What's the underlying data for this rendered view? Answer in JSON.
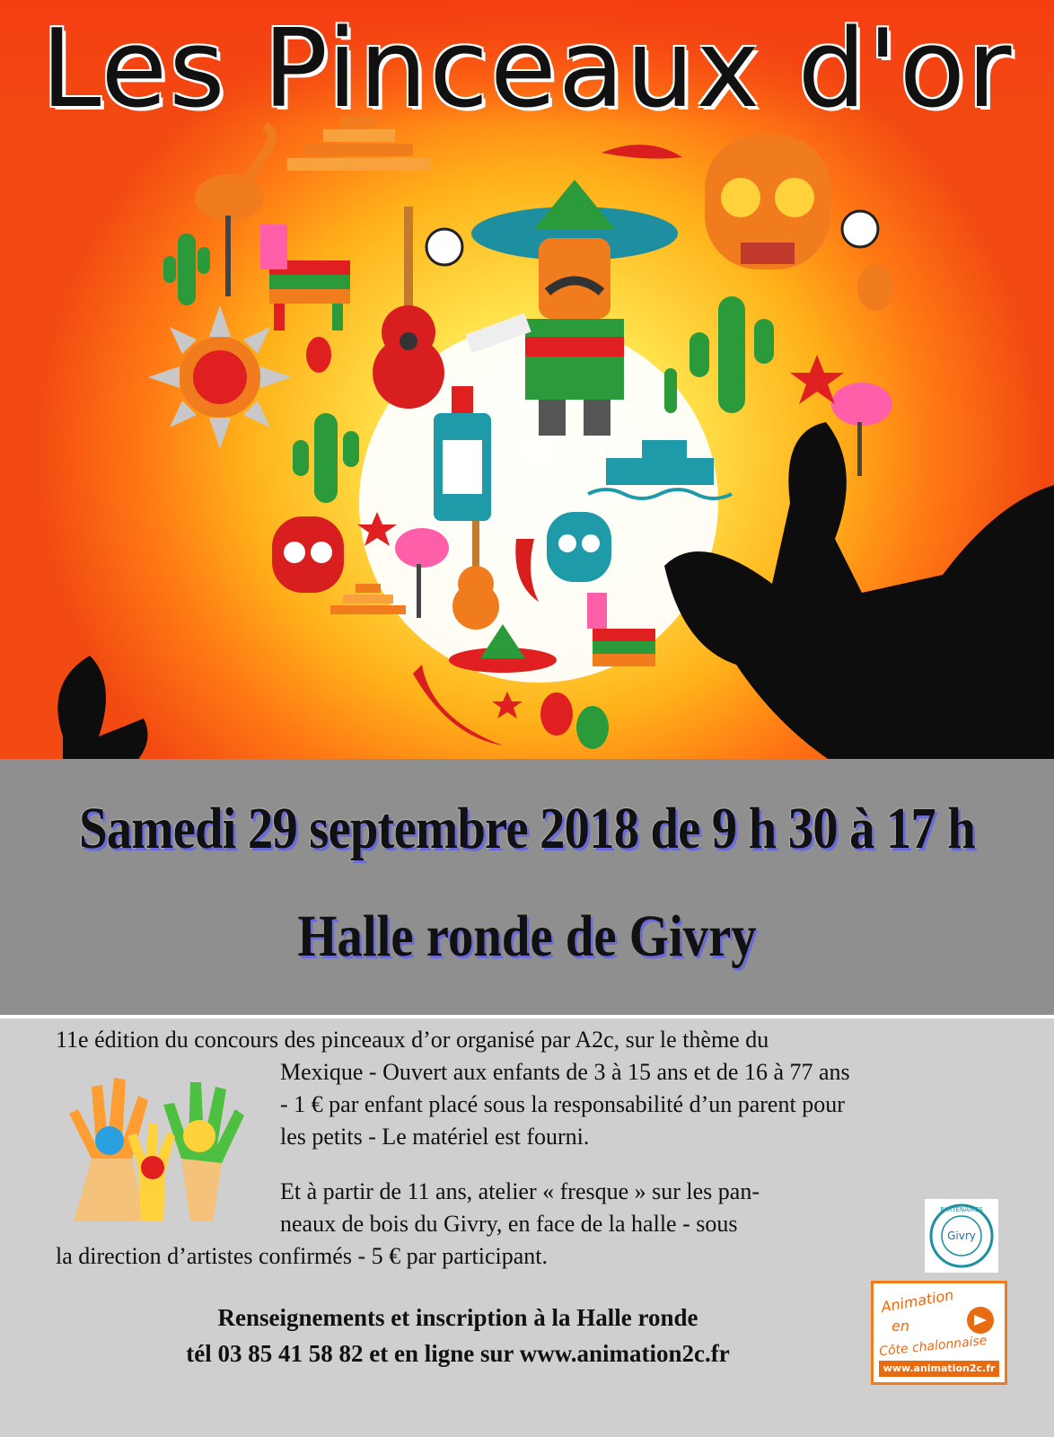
{
  "title": "Les Pinceaux d'or",
  "event": {
    "date_line": "Samedi 29 septembre 2018 de 9 h 30 à 17 h",
    "venue": "Halle ronde de Givry"
  },
  "description": {
    "line1": "11e  édition  du concours des pinceaux d’or organisé par A2c, sur le thème  du",
    "line2": "Mexique  - Ouvert aux enfants de 3 à 15 ans et de 16 à 77 ans",
    "line3": "- 1 € par enfant placé sous la responsabilité  d’un parent pour",
    "line4": "les petits - Le matériel est fourni.",
    "line5": "Et à partir de 11 ans, atelier « fresque » sur les pan-",
    "line6": "neaux de bois du Givry, en face de la halle - sous",
    "line7": "la direction d’artistes confirmés - 5 € par participant."
  },
  "contact": {
    "line1": "Renseignements et inscription à la Halle ronde",
    "line2": "tél 03 85 41 58 82 et en ligne sur www.animation2c.fr"
  },
  "partners": {
    "givry_ring": "PARTENAIRES",
    "givry_name": "Givry",
    "a2c_line1": "Animation",
    "a2c_line2": "en",
    "a2c_line3": "Côte chalonnaise",
    "a2c_url": "www.animation2c.fr"
  },
  "colors": {
    "sky_outer": "#f24a12",
    "sky_inner": "#ffe14a",
    "band_gray": "#8f8f8f",
    "info_gray": "#cfcfcf",
    "text_shadow_blue": "#6a6ad8",
    "brand_orange": "#e86b12"
  }
}
